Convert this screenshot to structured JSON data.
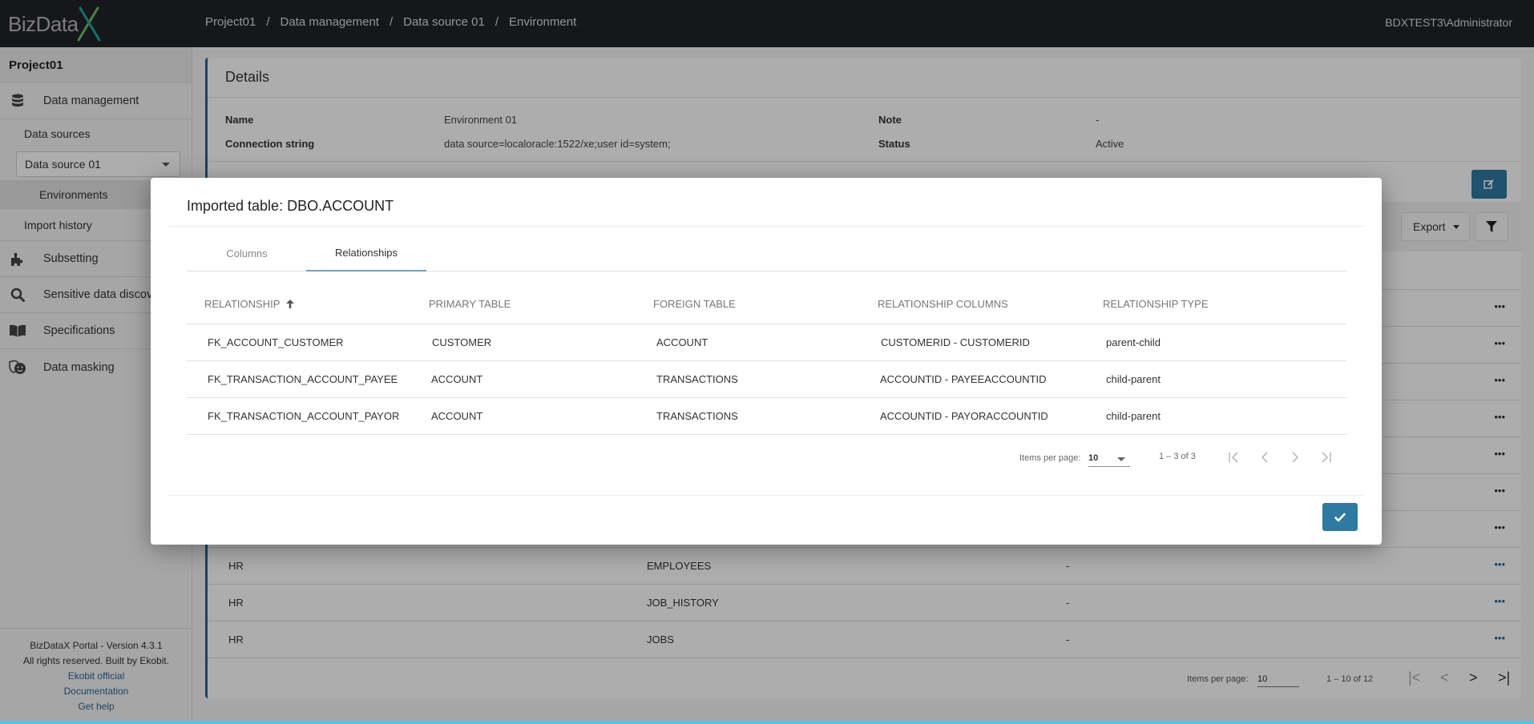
{
  "header": {
    "logo_text": "BizData",
    "breadcrumb": [
      "Project01",
      "Data management",
      "Data source 01",
      "Environment"
    ],
    "breadcrumb_separator": "/",
    "user": "BDXTEST3\\Administrator"
  },
  "sidebar": {
    "project": "Project01",
    "data_management": "Data management",
    "data_sources": "Data sources",
    "data_source_selected": "Data source 01",
    "environments": "Environments",
    "import_history": "Import history",
    "subsetting": "Subsetting",
    "sensitive_data_discovery": "Sensitive data discovery",
    "specifications": "Specifications",
    "data_masking": "Data masking",
    "footer": {
      "version": "BizDataX Portal - Version 4.3.1",
      "rights": "All rights reserved. Built by Ekobit.",
      "links": [
        "Ekobit official",
        "Documentation",
        "Get help"
      ]
    }
  },
  "details": {
    "title": "Details",
    "name_label": "Name",
    "name_value": "Environment 01",
    "connection_label": "Connection string",
    "connection_value": "data source=localoracle:1522/xe;user id=system;",
    "note_label": "Note",
    "note_value": "-",
    "status_label": "Status",
    "status_value": "Active"
  },
  "toolbar": {
    "export_label": "Export"
  },
  "background_table": {
    "visible_rows": [
      {
        "schema": "HR",
        "table": "EMPLOYEES",
        "note": "-"
      },
      {
        "schema": "HR",
        "table": "JOB_HISTORY",
        "note": "-"
      },
      {
        "schema": "HR",
        "table": "JOBS",
        "note": "-"
      }
    ],
    "pager": {
      "items_per_page_label": "Items per page:",
      "items_per_page": "10",
      "range": "1 – 10 of 12"
    }
  },
  "modal": {
    "title": "Imported table: DBO.ACCOUNT",
    "tabs": [
      {
        "label": "Columns",
        "active": false
      },
      {
        "label": "Relationships",
        "active": true
      }
    ],
    "columns": [
      "RELATIONSHIP",
      "PRIMARY TABLE",
      "FOREIGN TABLE",
      "RELATIONSHIP COLUMNS",
      "RELATIONSHIP TYPE"
    ],
    "sort": {
      "column": "RELATIONSHIP",
      "direction": "ascending"
    },
    "rows": [
      [
        "FK_ACCOUNT_CUSTOMER",
        "CUSTOMER",
        "ACCOUNT",
        "CUSTOMERID - CUSTOMERID",
        "parent-child"
      ],
      [
        "FK_TRANSACTION_ACCOUNT_PAYEE",
        "ACCOUNT",
        "TRANSACTIONS",
        "ACCOUNTID - PAYEEACCOUNTID",
        "child-parent"
      ],
      [
        "FK_TRANSACTION_ACCOUNT_PAYOR",
        "ACCOUNT",
        "TRANSACTIONS",
        "ACCOUNTID - PAYORACCOUNTID",
        "child-parent"
      ]
    ],
    "pager": {
      "items_per_page_label": "Items per page:",
      "items_per_page": "10",
      "range": "1 – 3 of 3"
    }
  },
  "colors": {
    "topbar": "#1f2228",
    "primary_button": "#2f7aa1",
    "link": "#2a6496",
    "active_tab_underline": "#6fa3bf"
  }
}
